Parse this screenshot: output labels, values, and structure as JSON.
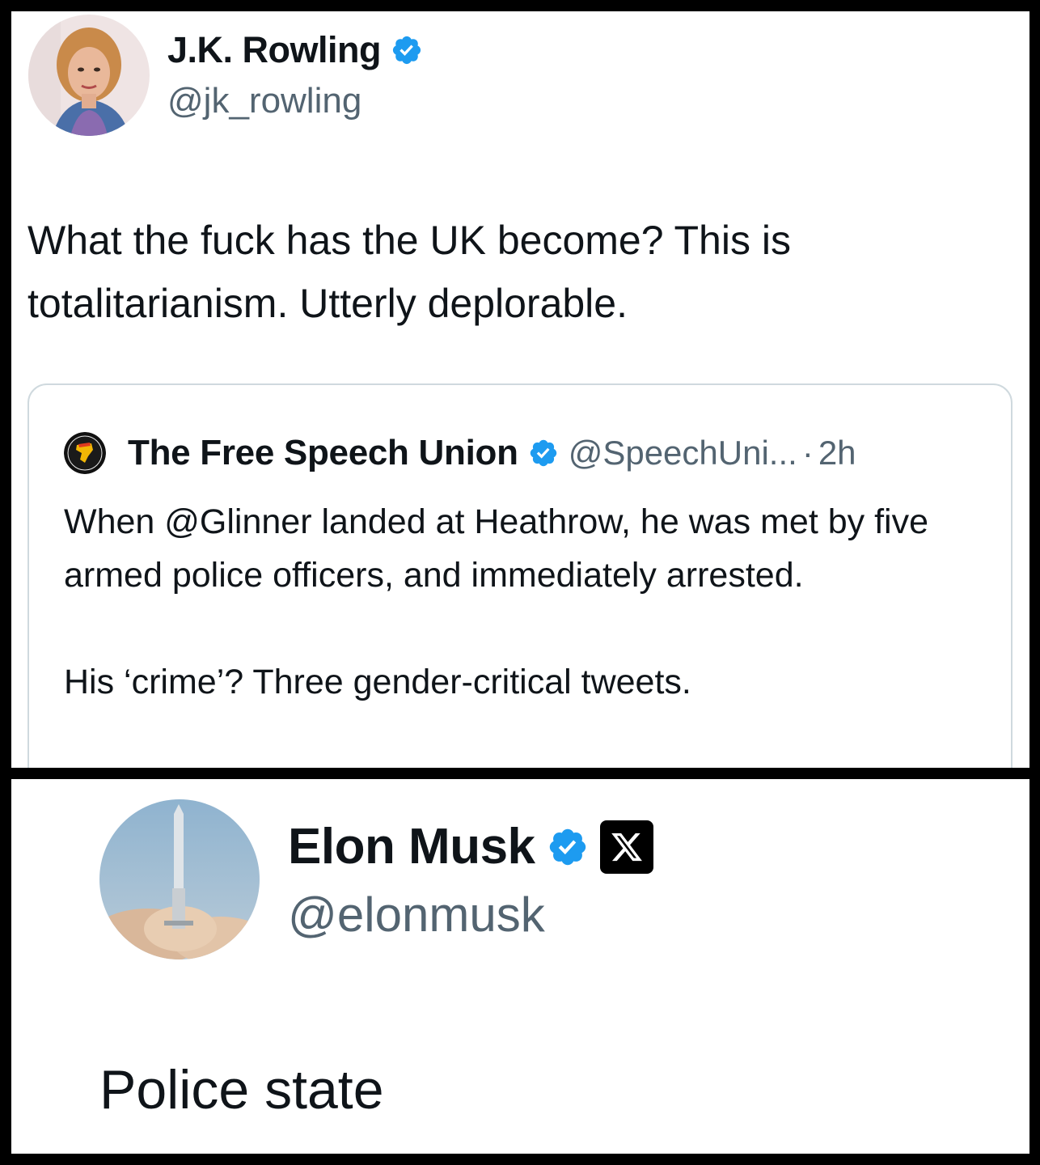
{
  "tweet_main": {
    "author_name": "J.K. Rowling",
    "author_handle": "@jk_rowling",
    "verified_icon": "verified-badge-icon",
    "text": "What the fuck has the UK become? This is totalitarianism. Utterly deplorable."
  },
  "quoted_tweet": {
    "author_name": "The Free Speech Union",
    "author_handle": "@SpeechUni...",
    "separator": "·",
    "time": "2h",
    "verified_icon": "verified-badge-icon",
    "paragraph_1": "When @Glinner landed at Heathrow, he was met by five armed police officers, and immediately arrested.",
    "paragraph_2": "His ‘crime’? Three gender-critical tweets."
  },
  "tweet_reply": {
    "author_name": "Elon Musk",
    "author_handle": "@elonmusk",
    "verified_icon": "verified-badge-icon",
    "affiliate_icon": "x-logo-icon",
    "text": "Police state"
  },
  "colors": {
    "verified_blue": "#1d9bf0",
    "text_primary": "#0f1419",
    "text_secondary": "#536471",
    "card_border": "#cfd9de",
    "frame": "#000000"
  }
}
